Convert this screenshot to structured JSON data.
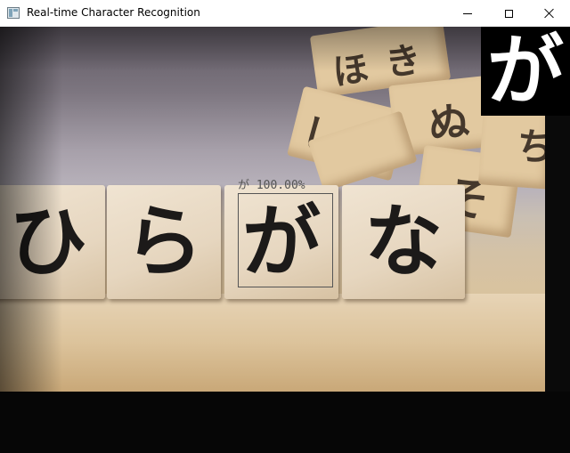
{
  "window": {
    "title": "Real-time Character Recognition",
    "icon": "opencv-window-icon",
    "controls": {
      "minimize": "minimize-icon",
      "maximize": "maximize-icon",
      "close": "close-icon"
    }
  },
  "camera": {
    "blocks": [
      {
        "char": "ひ"
      },
      {
        "char": "ら"
      },
      {
        "char": "が"
      },
      {
        "char": "な"
      }
    ],
    "detection": {
      "label": "が 100.00%"
    },
    "preview": {
      "char": "が"
    }
  }
}
